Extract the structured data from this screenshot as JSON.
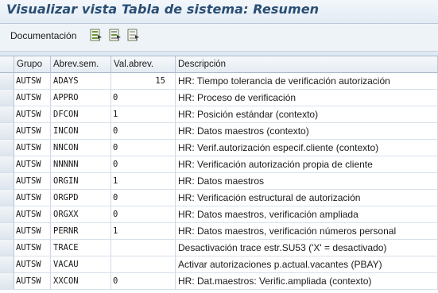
{
  "window": {
    "title": "Visualizar vista Tabla de sistema: Resumen"
  },
  "toolbar": {
    "doc_label": "Documentación",
    "icons": [
      "select-all-icon",
      "select-block-icon",
      "deselect-all-icon"
    ]
  },
  "table": {
    "headers": {
      "grupo": "Grupo",
      "abrev": "Abrev.sem.",
      "val": "Val.abrev.",
      "desc": "Descripción"
    },
    "rows": [
      {
        "grupo": "AUTSW",
        "abrev": "ADAYS",
        "val": "15",
        "desc": "HR: Tiempo tolerancia de verificación autorización"
      },
      {
        "grupo": "AUTSW",
        "abrev": "APPRO",
        "val": "0",
        "desc": "HR: Proceso de verificación"
      },
      {
        "grupo": "AUTSW",
        "abrev": "DFCON",
        "val": "1",
        "desc": "HR: Posición estándar (contexto)"
      },
      {
        "grupo": "AUTSW",
        "abrev": "INCON",
        "val": "0",
        "desc": "HR: Datos maestros (contexto)"
      },
      {
        "grupo": "AUTSW",
        "abrev": "NNCON",
        "val": "0",
        "desc": "HR: Verif.autorización especif.cliente (contexto)"
      },
      {
        "grupo": "AUTSW",
        "abrev": "NNNNN",
        "val": "0",
        "desc": "HR: Verificación autorización propia de cliente"
      },
      {
        "grupo": "AUTSW",
        "abrev": "ORGIN",
        "val": "1",
        "desc": "HR: Datos maestros"
      },
      {
        "grupo": "AUTSW",
        "abrev": "ORGPD",
        "val": "0",
        "desc": "HR: Verificación estructural de autorización"
      },
      {
        "grupo": "AUTSW",
        "abrev": "ORGXX",
        "val": "0",
        "desc": "HR: Datos maestros, verificación ampliada"
      },
      {
        "grupo": "AUTSW",
        "abrev": "PERNR",
        "val": "1",
        "desc": "HR: Datos maestros, verificación números personal"
      },
      {
        "grupo": "AUTSW",
        "abrev": "TRACE",
        "val": "",
        "desc": "Desactivación trace estr.SU53 ('X' = desactivado)"
      },
      {
        "grupo": "AUTSW",
        "abrev": "VACAU",
        "val": "",
        "desc": "Activar autorizaciones p.actual.vacantes (PBAY)"
      },
      {
        "grupo": "AUTSW",
        "abrev": "XXCON",
        "val": "0",
        "desc": "HR: Dat.maestros: Verific.ampliada (contexto)"
      }
    ]
  }
}
